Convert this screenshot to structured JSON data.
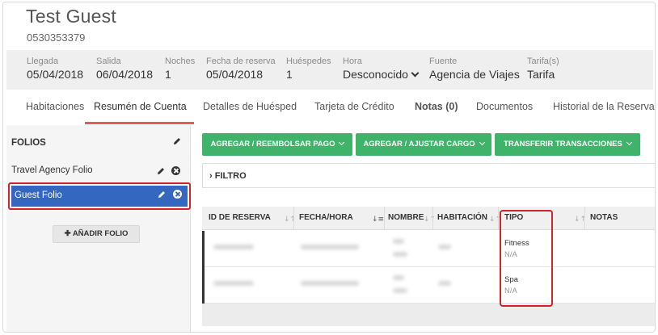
{
  "guest": {
    "name": "Test Guest",
    "phone": "0530353379"
  },
  "info": {
    "arrival": {
      "label": "Llegada",
      "value": "05/04/2018"
    },
    "departure": {
      "label": "Salida",
      "value": "06/04/2018"
    },
    "nights": {
      "label": "Noches",
      "value": "1"
    },
    "booking_date": {
      "label": "Fecha de reserva",
      "value": "05/04/2018"
    },
    "guests": {
      "label": "Huéspedes",
      "value": "1"
    },
    "time": {
      "label": "Hora",
      "value": "Desconocido"
    },
    "source": {
      "label": "Fuente",
      "value": "Agencia de Viajes"
    },
    "rates": {
      "label": "Tarifa(s)",
      "value": "Tarifa"
    }
  },
  "tabs": [
    {
      "label": "Habitaciones"
    },
    {
      "label": "Resumén de Cuenta"
    },
    {
      "label": "Detalles de Huésped"
    },
    {
      "label": "Tarjeta de Crédito"
    },
    {
      "label": "Notas (0)"
    },
    {
      "label": "Documentos"
    },
    {
      "label": "Historial de la Reserva"
    }
  ],
  "sidebar": {
    "title": "FOLIOS",
    "folios": [
      {
        "name": "Travel Agency Folio"
      },
      {
        "name": "Guest Folio"
      }
    ],
    "add_button": "AÑADIR FOLIO"
  },
  "actions": {
    "payment": "AGREGAR / REEMBOLSAR PAGO",
    "charge": "AGREGAR / AJUSTAR CARGO",
    "transfer": "TRANSFERIR TRANSACCIONES"
  },
  "filter": {
    "label": "FILTRO"
  },
  "table": {
    "columns": [
      "ID DE RESERVA",
      "FECHA/HORA",
      "NOMBRE",
      "HABITACIÓN",
      "TIPO",
      "NOTAS"
    ],
    "rows": [
      {
        "tipo": "Fitness",
        "tipo_sub": "N/A"
      },
      {
        "tipo": "Spa",
        "tipo_sub": "N/A"
      }
    ]
  },
  "colors": {
    "accent_green": "#3fb36a",
    "selected_blue": "#3467c0",
    "highlight_red": "#d2232a",
    "tab_underline": "#e05a63"
  }
}
